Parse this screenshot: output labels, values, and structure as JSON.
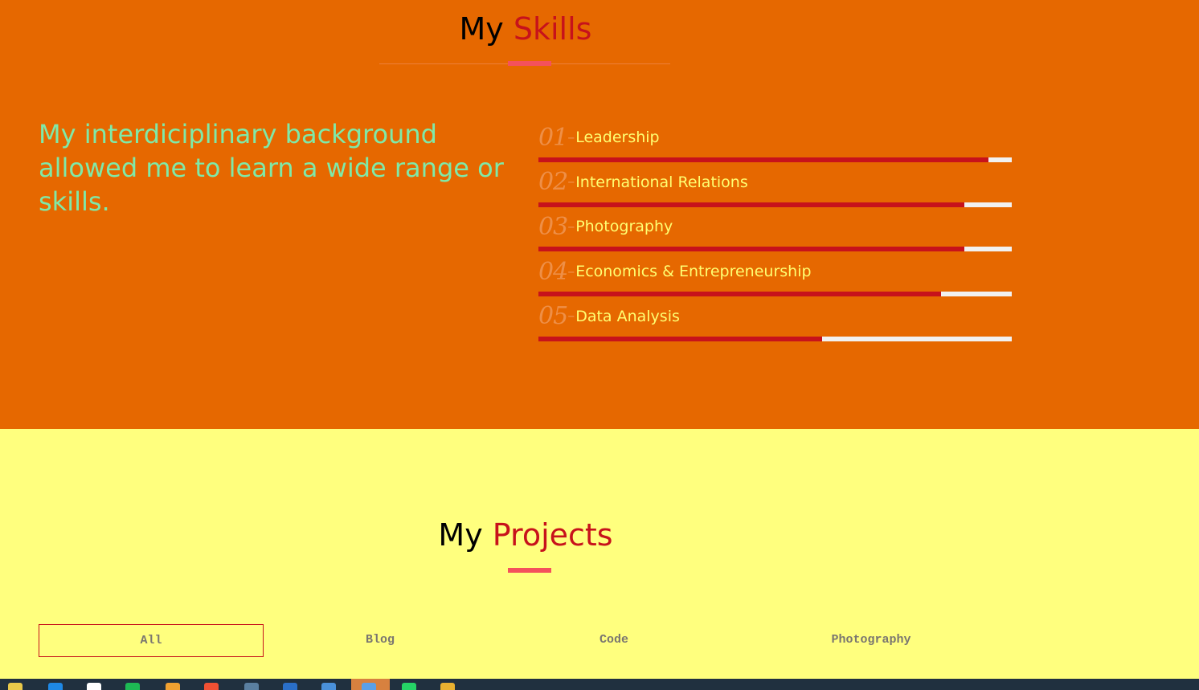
{
  "skills": {
    "title_prefix": "My",
    "title_highlight": "Skills",
    "intro": "My interdiciplinary background allowed me to learn a wide range or skills.",
    "items": [
      {
        "number": "01",
        "dash": "–",
        "name": "Leadership",
        "level": 95
      },
      {
        "number": "02",
        "dash": "–",
        "name": "International Relations",
        "level": 90
      },
      {
        "number": "03",
        "dash": "–",
        "name": "Photography",
        "level": 90
      },
      {
        "number": "04",
        "dash": "–",
        "name": "Economics & Entrepreneurship",
        "level": 85
      },
      {
        "number": "05",
        "dash": "–",
        "name": "Data Analysis",
        "level": 60
      }
    ]
  },
  "projects": {
    "title_prefix": "My",
    "title_highlight": "Projects",
    "filters": [
      {
        "label": "All",
        "active": true
      },
      {
        "label": "Blog",
        "active": false
      },
      {
        "label": "Code",
        "active": false
      },
      {
        "label": "Photography",
        "active": false
      }
    ]
  },
  "taskbar": {
    "icons": [
      {
        "name": "start-icon",
        "color": "#e8c84a"
      },
      {
        "name": "calendar-icon",
        "color": "#1e88e5"
      },
      {
        "name": "github-icon",
        "color": "#ffffff"
      },
      {
        "name": "spotify-icon",
        "color": "#1db954"
      },
      {
        "name": "pencil-icon",
        "color": "#f0a030"
      },
      {
        "name": "git-icon",
        "color": "#f05033"
      },
      {
        "name": "terminal-icon",
        "color": "#5a7fa0"
      },
      {
        "name": "powershell-icon",
        "color": "#2a6fc9"
      },
      {
        "name": "chrome-icon",
        "color": "#4a90d9"
      },
      {
        "name": "app-icon",
        "color": "#5aa0e8"
      },
      {
        "name": "whatsapp-icon",
        "color": "#25d366"
      },
      {
        "name": "paint-icon",
        "color": "#e8b030"
      }
    ]
  },
  "colors": {
    "skills_bg": "#e66800",
    "projects_bg": "#ffff7e",
    "accent_red": "#c7121b",
    "accent_pink": "#f4515c",
    "intro_green": "#7fe9a8",
    "skill_name_yellow": "#ffff72",
    "skill_number_orange": "#ee8f47"
  }
}
